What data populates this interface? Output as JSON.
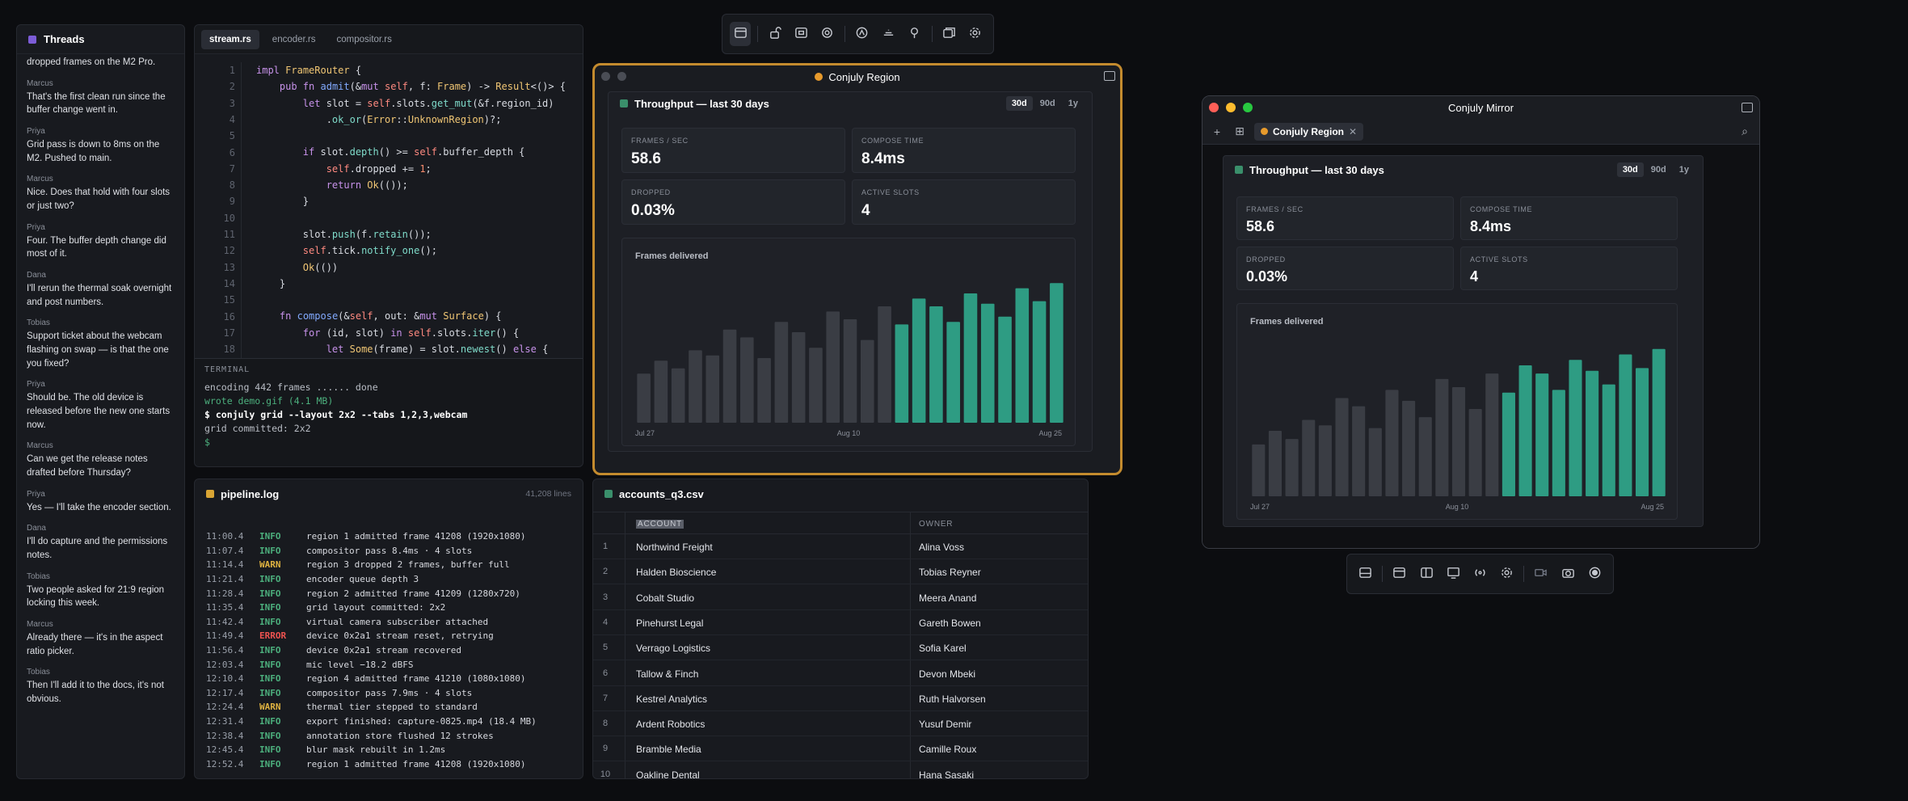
{
  "threads": {
    "title": "Threads",
    "messages": [
      {
        "who": "",
        "text": "dropped frames on the M2 Pro."
      },
      {
        "who": "Marcus",
        "text": "That's the first clean run since the buffer change went in."
      },
      {
        "who": "Priya",
        "text": "Grid pass is down to 8ms on the M2. Pushed to main."
      },
      {
        "who": "Marcus",
        "text": "Nice. Does that hold with four slots or just two?"
      },
      {
        "who": "Priya",
        "text": "Four. The buffer depth change did most of it."
      },
      {
        "who": "Dana",
        "text": "I'll rerun the thermal soak overnight and post numbers."
      },
      {
        "who": "Tobias",
        "text": "Support ticket about the webcam flashing on swap — is that the one you fixed?"
      },
      {
        "who": "Priya",
        "text": "Should be. The old device is released before the new one starts now."
      },
      {
        "who": "Marcus",
        "text": "Can we get the release notes drafted before Thursday?"
      },
      {
        "who": "Priya",
        "text": "Yes — I'll take the encoder section."
      },
      {
        "who": "Dana",
        "text": "I'll do capture and the permissions notes."
      },
      {
        "who": "Tobias",
        "text": "Two people asked for 21:9 region locking this week."
      },
      {
        "who": "Marcus",
        "text": "Already there — it's in the aspect ratio picker."
      },
      {
        "who": "Tobias",
        "text": "Then I'll add it to the docs, it's not obvious."
      }
    ]
  },
  "editor": {
    "tabs": [
      "stream.rs",
      "encoder.rs",
      "compositor.rs"
    ],
    "line_numbers": [
      "1",
      "2",
      "3",
      "4",
      "5",
      "6",
      "7",
      "8",
      "9",
      "10",
      "11",
      "12",
      "13",
      "14",
      "15",
      "16",
      "17",
      "18"
    ],
    "terminal": {
      "label": "TERMINAL",
      "lines": [
        "encoding 442 frames ...... done",
        "wrote demo.gif (4.1 MB)",
        "",
        "$ conjuly grid --layout 2x2 --tabs 1,2,3,webcam",
        "grid committed: 2x2",
        "$"
      ]
    }
  },
  "pipeline": {
    "title": "pipeline.log",
    "line_count": "41,208 lines",
    "logs": [
      {
        "t": "11:00.4",
        "lv": "INFO",
        "m": "region 1 admitted frame 41208 (1920x1080)"
      },
      {
        "t": "11:07.4",
        "lv": "INFO",
        "m": "compositor pass 8.4ms · 4 slots"
      },
      {
        "t": "11:14.4",
        "lv": "WARN",
        "m": "region 3 dropped 2 frames, buffer full"
      },
      {
        "t": "11:21.4",
        "lv": "INFO",
        "m": "encoder queue depth 3"
      },
      {
        "t": "11:28.4",
        "lv": "INFO",
        "m": "region 2 admitted frame 41209 (1280x720)"
      },
      {
        "t": "11:35.4",
        "lv": "INFO",
        "m": "grid layout committed: 2x2"
      },
      {
        "t": "11:42.4",
        "lv": "INFO",
        "m": "virtual camera subscriber attached"
      },
      {
        "t": "11:49.4",
        "lv": "ERROR",
        "m": "device 0x2a1 stream reset, retrying"
      },
      {
        "t": "11:56.4",
        "lv": "INFO",
        "m": "device 0x2a1 stream recovered"
      },
      {
        "t": "12:03.4",
        "lv": "INFO",
        "m": "mic level −18.2 dBFS"
      },
      {
        "t": "12:10.4",
        "lv": "INFO",
        "m": "region 4 admitted frame 41210 (1080x1080)"
      },
      {
        "t": "12:17.4",
        "lv": "INFO",
        "m": "compositor pass 7.9ms · 4 slots"
      },
      {
        "t": "12:24.4",
        "lv": "WARN",
        "m": "thermal tier stepped to standard"
      },
      {
        "t": "12:31.4",
        "lv": "INFO",
        "m": "export finished: capture-0825.mp4 (18.4 MB)"
      },
      {
        "t": "12:38.4",
        "lv": "INFO",
        "m": "annotation store flushed 12 strokes"
      },
      {
        "t": "12:45.4",
        "lv": "INFO",
        "m": "blur mask rebuilt in 1.2ms"
      },
      {
        "t": "12:52.4",
        "lv": "INFO",
        "m": "region 1 admitted frame 41208 (1920x1080)"
      }
    ]
  },
  "region": {
    "title": "Conjuly Region"
  },
  "dashboard": {
    "title": "Throughput — last 30 days",
    "ranges": [
      "30d",
      "90d",
      "1y"
    ],
    "active_range": "30d",
    "stats": [
      {
        "k": "FRAMES / SEC",
        "v": "58.6"
      },
      {
        "k": "COMPOSE TIME",
        "v": "8.4ms"
      },
      {
        "k": "DROPPED",
        "v": "0.03%"
      },
      {
        "k": "ACTIVE SLOTS",
        "v": "4"
      }
    ],
    "chart_title": "Frames delivered"
  },
  "chart_data": {
    "type": "bar",
    "title": "Frames delivered",
    "x_tick_labels": [
      "Jul 27",
      "Aug 10",
      "Aug 25"
    ],
    "values": [
      38,
      48,
      42,
      56,
      52,
      72,
      66,
      50,
      78,
      70,
      58,
      86,
      80,
      64,
      90,
      76,
      96,
      90,
      78,
      100,
      92,
      82,
      104,
      94,
      108
    ],
    "highlight_from_index": 15,
    "colors": {
      "muted": "#3a3d44",
      "highlight": "#2e9c83"
    },
    "ylim": [
      0,
      115
    ]
  },
  "accounts": {
    "title": "accounts_q3.csv",
    "columns": [
      "ACCOUNT",
      "OWNER"
    ],
    "rows": [
      {
        "i": "1",
        "a": "Northwind Freight",
        "o": "Alina Voss"
      },
      {
        "i": "2",
        "a": "Halden Bioscience",
        "o": "Tobias Reyner"
      },
      {
        "i": "3",
        "a": "Cobalt Studio",
        "o": "Meera Anand"
      },
      {
        "i": "4",
        "a": "Pinehurst Legal",
        "o": "Gareth Bowen"
      },
      {
        "i": "5",
        "a": "Verrago Logistics",
        "o": "Sofia Karel"
      },
      {
        "i": "6",
        "a": "Tallow & Finch",
        "o": "Devon Mbeki"
      },
      {
        "i": "7",
        "a": "Kestrel Analytics",
        "o": "Ruth Halvorsen"
      },
      {
        "i": "8",
        "a": "Ardent Robotics",
        "o": "Yusuf Demir"
      },
      {
        "i": "9",
        "a": "Bramble Media",
        "o": "Camille Roux"
      },
      {
        "i": "10",
        "a": "Oakline Dental",
        "o": "Hana Sasaki"
      }
    ]
  },
  "mirror": {
    "title": "Conjuly Mirror",
    "tab_label": "Conjuly Region"
  },
  "colors": {
    "accent_orange": "#c48b2e",
    "teal": "#2e9c83",
    "purple": "#7c5cd6",
    "green_square": "#3a8f6b",
    "yellow_square": "#d9a534"
  }
}
